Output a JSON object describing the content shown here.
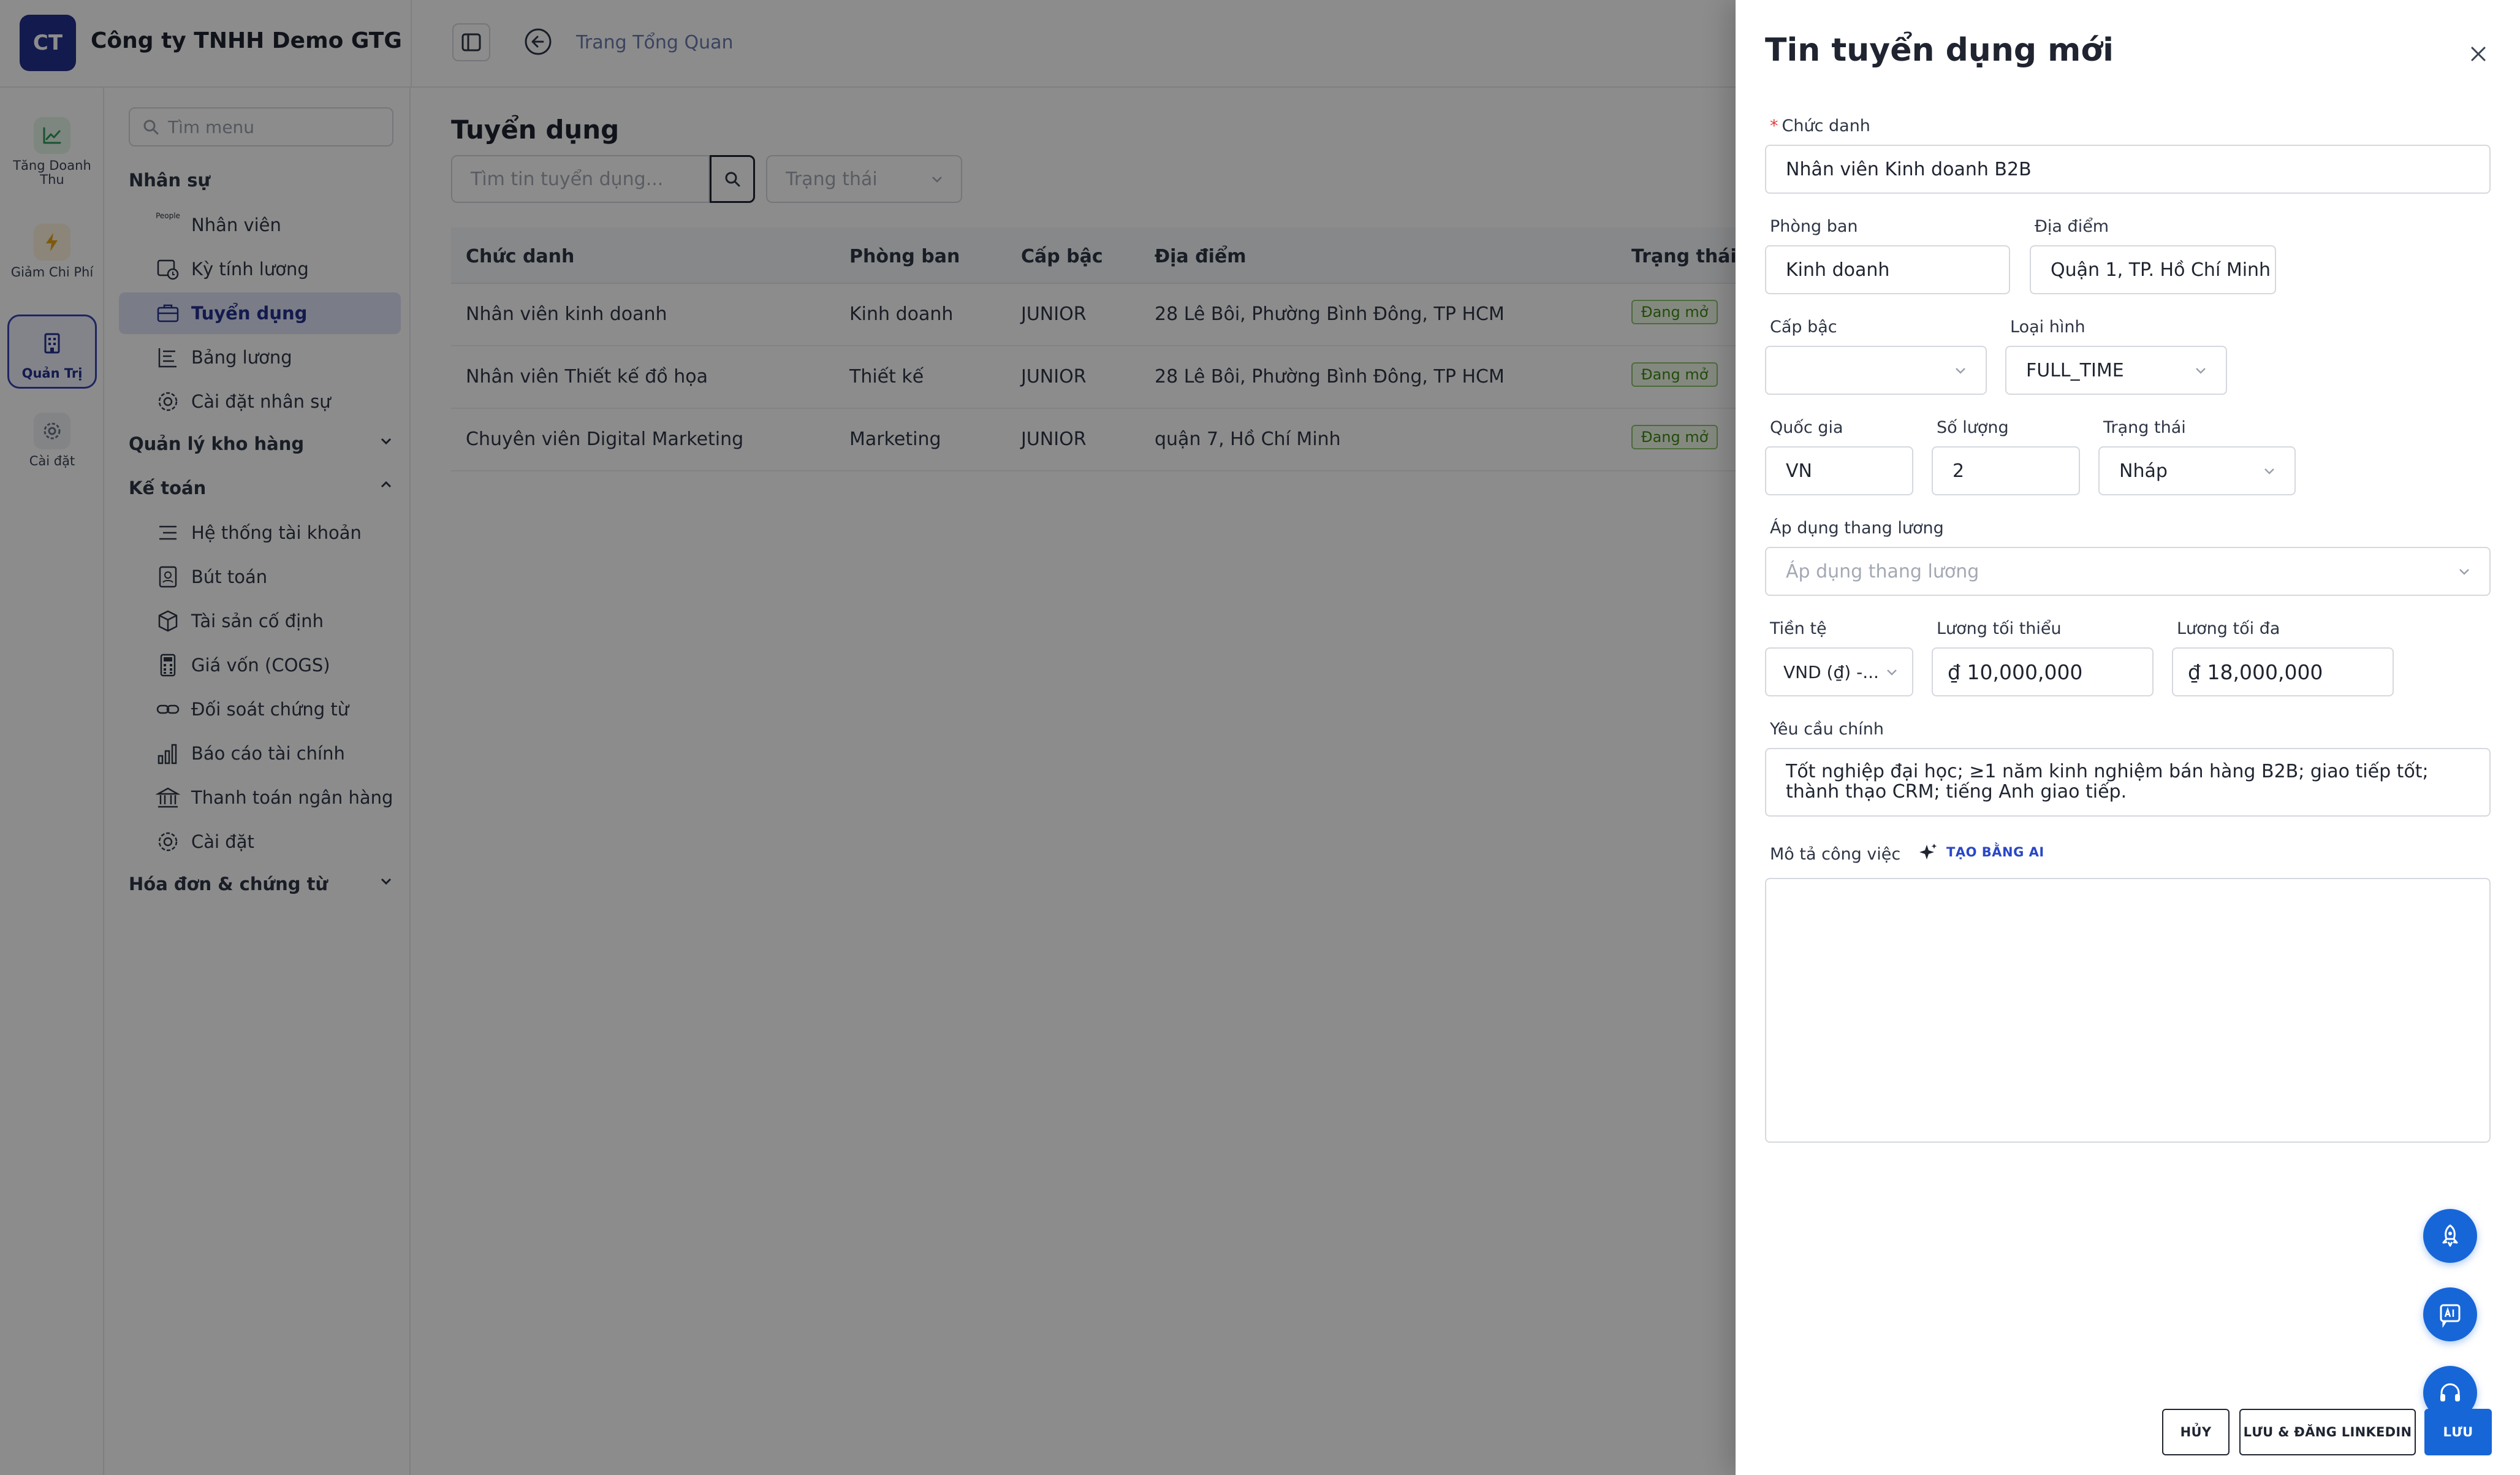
{
  "company": {
    "logo_text": "CT",
    "name": "Công ty TNHH Demo GTG"
  },
  "breadcrumb": "Trang Tổng Quan",
  "rail": [
    {
      "label": "Tăng Doanh Thu",
      "icon": "trend-up-icon"
    },
    {
      "label": "Giảm Chi Phí",
      "icon": "lightning-icon"
    },
    {
      "label": "Quản Trị",
      "icon": "building-icon",
      "active": true
    },
    {
      "label": "Cài đặt",
      "icon": "gear-icon"
    }
  ],
  "menu": {
    "search_placeholder": "Tìm menu",
    "groups": {
      "nhan_su": "Nhân sự",
      "kho_hang": "Quản lý kho hàng",
      "ke_toan": "Kế toán",
      "hoa_don": "Hóa đơn & chứng từ"
    },
    "items": {
      "nhan_vien": "Nhân viên",
      "ky_tinh_luong": "Kỳ tính lương",
      "tuyen_dung": "Tuyển dụng",
      "bang_luong": "Bảng lương",
      "cai_dat_nhan_su": "Cài đặt nhân sự",
      "he_thong_tai_khoan": "Hệ thống tài khoản",
      "but_toan": "Bút toán",
      "tai_san": "Tài sản cố định",
      "gia_von": "Giá vốn (COGS)",
      "doi_soat": "Đối soát chứng từ",
      "bao_cao": "Báo cáo tài chính",
      "thanh_toan": "Thanh toán ngân hàng",
      "cai_dat": "Cài đặt"
    },
    "people_icon_text": "People"
  },
  "page": {
    "title": "Tuyển dụng",
    "search_placeholder": "Tìm tin tuyển dụng...",
    "status_placeholder": "Trạng thái"
  },
  "table": {
    "headers": [
      "Chức danh",
      "Phòng ban",
      "Cấp bậc",
      "Địa điểm",
      "Trạng thái"
    ],
    "rows": [
      [
        "Nhân viên kinh doanh",
        "Kinh doanh",
        "JUNIOR",
        "28 Lê Bôi, Phường Bình Đông, TP HCM",
        "Đang mở"
      ],
      [
        "Nhân viên Thiết kế đồ họa",
        "Thiết kế",
        "JUNIOR",
        "28 Lê Bôi, Phường Bình Đông, TP HCM",
        "Đang mở"
      ],
      [
        "Chuyên viên Digital Marketing",
        "Marketing",
        "JUNIOR",
        "quận 7, Hồ Chí Minh",
        "Đang mở"
      ]
    ]
  },
  "drawer": {
    "title": "Tin tuyển dụng mới",
    "fields": {
      "chuc_danh": {
        "label": "Chức danh",
        "value": "Nhân viên Kinh doanh B2B"
      },
      "phong_ban": {
        "label": "Phòng ban",
        "value": "Kinh doanh"
      },
      "dia_diem": {
        "label": "Địa điểm",
        "value": "Quận 1, TP. Hồ Chí Minh"
      },
      "cap_bac": {
        "label": "Cấp bậc",
        "value": ""
      },
      "loai_hinh": {
        "label": "Loại hình",
        "value": "FULL_TIME"
      },
      "quoc_gia": {
        "label": "Quốc gia",
        "value": "VN"
      },
      "so_luong": {
        "label": "Số lượng",
        "value": "2"
      },
      "trang_thai": {
        "label": "Trạng thái",
        "value": "Nháp"
      },
      "thang_luong": {
        "label": "Áp dụng thang lương",
        "placeholder": "Áp dụng thang lương"
      },
      "tien_te": {
        "label": "Tiền tệ",
        "value": "VND (₫) -..."
      },
      "luong_toi_thieu": {
        "label": "Lương tối thiểu",
        "value": "₫ 10,000,000"
      },
      "luong_toi_da": {
        "label": "Lương tối đa",
        "value": "₫ 18,000,000"
      },
      "yeu_cau": {
        "label": "Yêu cầu chính",
        "value": "Tốt nghiệp đại học; ≥1 năm kinh nghiệm bán hàng B2B; giao tiếp tốt; thành thạo CRM; tiếng Anh giao tiếp."
      },
      "mo_ta": {
        "label": "Mô tả công việc",
        "value": ""
      }
    },
    "ai_button": "TẠO BẰNG AI",
    "buttons": {
      "cancel": "HỦY",
      "save_linkedin": "LƯU & ĐĂNG LINKEDIN",
      "save": "LƯU"
    }
  },
  "colors": {
    "brand": "#24308f",
    "primary": "#1766d8",
    "success": "#3c8a12",
    "danger": "#e03c3c"
  }
}
